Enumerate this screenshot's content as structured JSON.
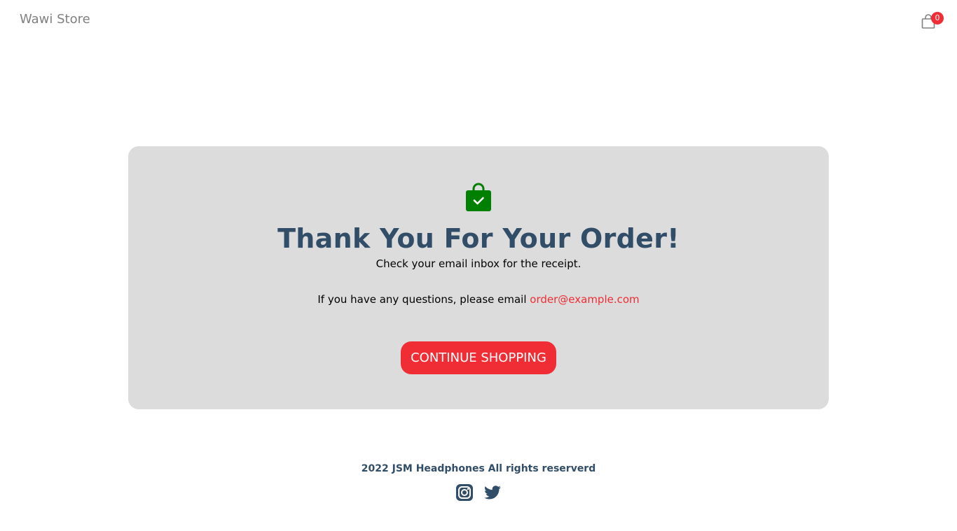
{
  "navbar": {
    "logo_text": "Wawi Store",
    "cart_count": "0",
    "cart_icon": "shopping-bag-icon"
  },
  "success": {
    "icon": "bag-check-icon",
    "title": "Thank You For Your Order!",
    "email_msg": "Check your email inbox for the receipt.",
    "description_text": "If you have any questions, please email ",
    "contact_email": "order@example.com",
    "button_label": "CONTINUE SHOPPING"
  },
  "footer": {
    "copyright": "2022 JSM Headphones All rights reserverd",
    "social_icons": [
      "instagram-icon",
      "twitter-icon"
    ]
  },
  "colors": {
    "accent": "#f02d34",
    "heading": "#324d67",
    "card_bg": "#dcdcdc",
    "success_icon": "#008000"
  }
}
